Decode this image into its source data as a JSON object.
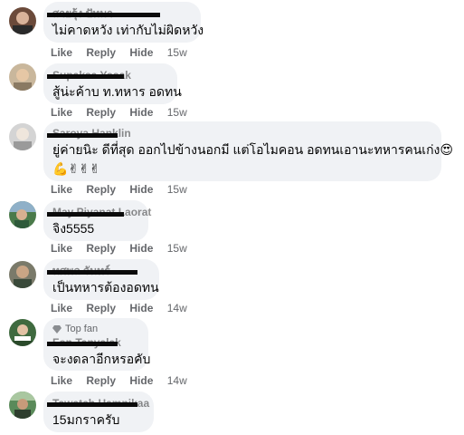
{
  "actions": {
    "like": "Like",
    "reply": "Reply",
    "hide": "Hide"
  },
  "comments": [
    {
      "author": "สายรุ้ง ปัทมา",
      "text": "ไม่คาดหวัง เท่ากับไม่ผิดหวัง",
      "time": "15w"
    },
    {
      "author": "Supaksa Yosak",
      "text": "สู้น่ะค้าบ ท.ทหาร อดทน",
      "time": "15w"
    },
    {
      "author": "Saroya Hanklin",
      "text": "ยู่ค่ายนิะ ดีที่สุด ออกไปข้างนอกมี แต่โอไมคอน อดทนเอานะทหารคนเก่ง😍",
      "emojis": "💪✌✌✌",
      "time": "15w"
    },
    {
      "author": "May Piyanat Laorat",
      "text": "จิง5555",
      "time": "15w"
    },
    {
      "author": "ทศพล จันทร์",
      "text": "เป็นทหารต้องอดทน",
      "time": "14w"
    },
    {
      "author": "Fon Tanyalak",
      "badge": "Top fan",
      "text": "จะงดลาอีกหรอคับ",
      "time": "14w"
    },
    {
      "author": "Tawatch Hamnikaa",
      "text": "15มกราครับ",
      "time": ""
    }
  ]
}
